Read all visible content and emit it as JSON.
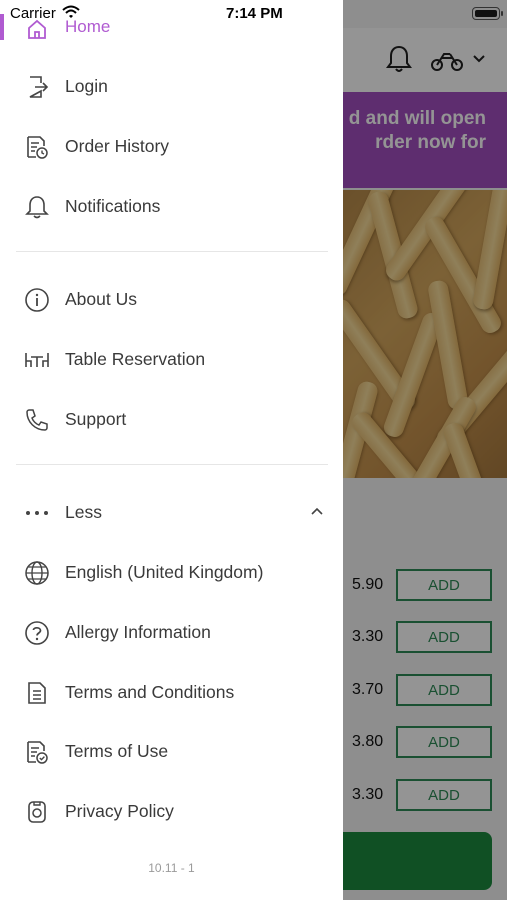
{
  "status_bar": {
    "carrier": "Carrier",
    "time": "7:14 PM"
  },
  "drawer": {
    "home_label": "Home",
    "menu": {
      "login": "Login",
      "order_history": "Order History",
      "notifications": "Notifications",
      "about_us": "About Us",
      "table_reservation": "Table Reservation",
      "support": "Support",
      "less": "Less",
      "language": "English (United Kingdom)",
      "allergy": "Allergy Information",
      "terms_conditions": "Terms and Conditions",
      "terms_of_use": "Terms of Use",
      "privacy_policy": "Privacy Policy"
    },
    "version": "10.11 - 1"
  },
  "background": {
    "banner_line1": "d and will open",
    "banner_line2": "rder now for",
    "items": [
      {
        "price": "5.90",
        "add": "ADD"
      },
      {
        "price": "3.30",
        "add": "ADD"
      },
      {
        "price": "3.70",
        "add": "ADD"
      },
      {
        "price": "3.80",
        "add": "ADD"
      },
      {
        "price": "3.30",
        "add": "ADD"
      }
    ]
  },
  "colors": {
    "accent": "#b05bd1",
    "banner": "#a24fbf",
    "add_green": "#2e8b57",
    "checkout_green": "#1c8a3f"
  }
}
